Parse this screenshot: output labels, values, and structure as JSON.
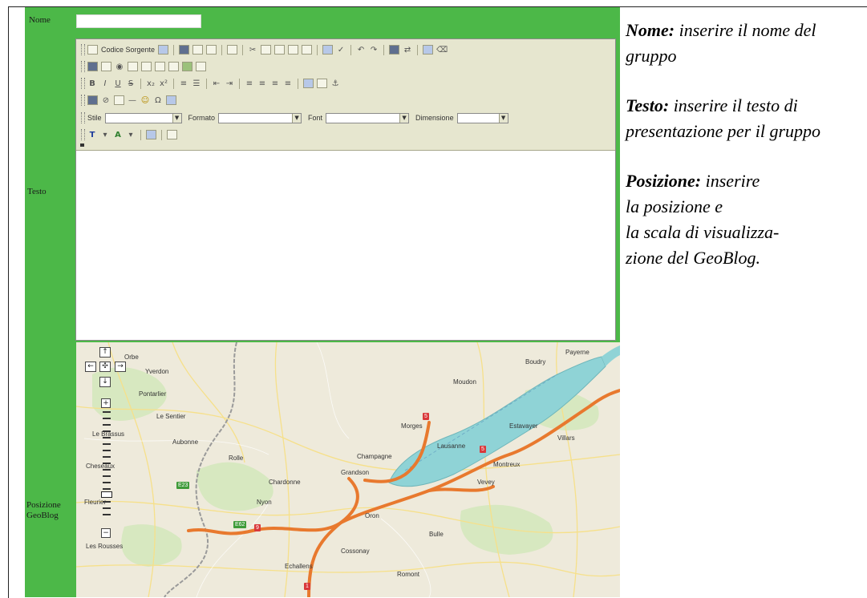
{
  "form": {
    "nome_label": "Nome",
    "nome_value": "",
    "testo_label": "Testo",
    "posizione_label_line1": "Posizione",
    "posizione_label_line2": "GeoBlog"
  },
  "editor": {
    "source_button": "Codice Sorgente",
    "combos": [
      {
        "label": "Stile",
        "value": ""
      },
      {
        "label": "Formato",
        "value": ""
      },
      {
        "label": "Font",
        "value": ""
      },
      {
        "label": "Dimensione",
        "value": ""
      }
    ],
    "content": ""
  },
  "map": {
    "places": [
      "Yverdon",
      "Orbe",
      "Pontarlier",
      "Le Sentier",
      "Champagne",
      "Grandson",
      "Lausanne",
      "Morges",
      "Montreux",
      "Vevey",
      "Chardonne",
      "Le Brassus",
      "Nyon",
      "Rolle",
      "Aubonne",
      "Cossonay",
      "Echallens",
      "Oron",
      "Bulle",
      "Romont",
      "Moudon",
      "Payerne",
      "Estavayer",
      "Villars",
      "Boudry",
      "Fleurier",
      "Les Rousses",
      "Cheseaux"
    ],
    "shields": [
      "5",
      "5",
      "E23",
      "E62",
      "9",
      "1"
    ],
    "colors": {
      "water": "#8fd3d6",
      "highway": "#e8792e",
      "land": "#eeeadb",
      "forest": "#cfe3b5"
    }
  },
  "caption": [
    {
      "term": "Nome:",
      "text": "inserire il nome del gruppo"
    },
    {
      "term": "Testo:",
      "text": "inserire il testo di presentazione per il gruppo"
    },
    {
      "term": "Posizione:",
      "text_lines": [
        "inserire",
        "la posizione e",
        "la scala di visualizza-",
        "zione del GeoBlog."
      ]
    }
  ],
  "colors": {
    "panel": "#4cb848",
    "toolbar": "#e6e6cf"
  }
}
